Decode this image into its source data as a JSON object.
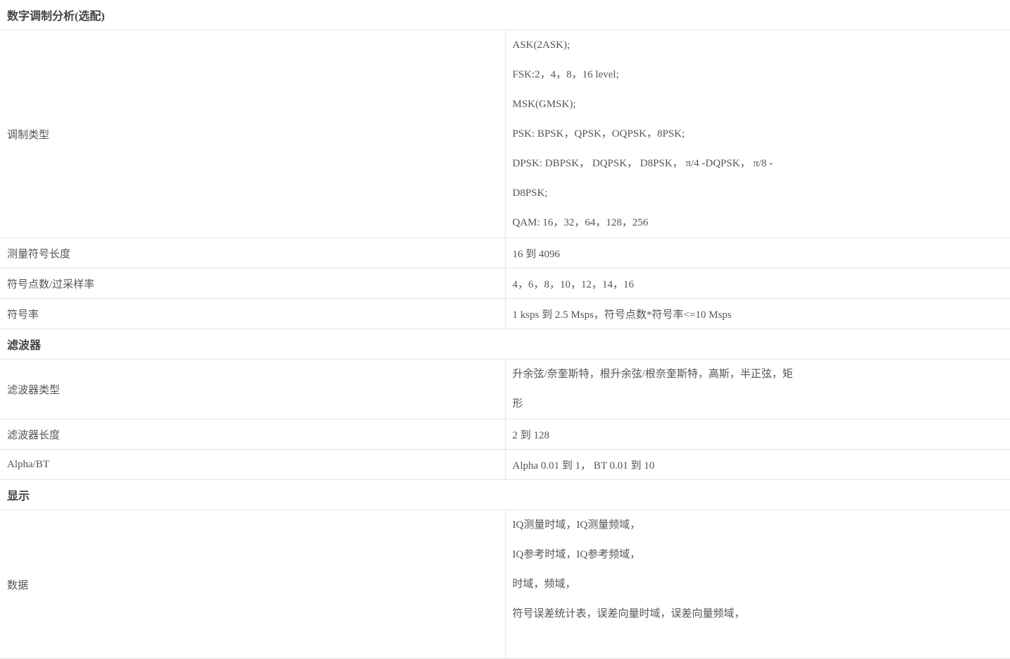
{
  "sections": {
    "digital_mod": "数字调制分析(选配)",
    "filter": "滤波器",
    "display": "显示"
  },
  "rows": {
    "mod_type": {
      "label": "调制类型",
      "lines": [
        "ASK(2ASK);",
        "FSK:2，4，8，16 level;",
        "MSK(GMSK);",
        "PSK: BPSK，QPSK，OQPSK，8PSK;",
        "DPSK: DBPSK， DQPSK， D8PSK， π/4 -DQPSK， π/8 -",
        "D8PSK;",
        "QAM: 16，32，64，128，256"
      ]
    },
    "symbol_length": {
      "label": "测量符号长度",
      "value": "16 到 4096"
    },
    "oversample": {
      "label": "符号点数/过采样率",
      "value": "4，6，8，10，12，14，16"
    },
    "symbol_rate": {
      "label": "符号率",
      "value": "1 ksps 到 2.5 Msps，符号点数*符号率<=10 Msps"
    },
    "filter_type": {
      "label": "滤波器类型",
      "lines": [
        "升余弦/奈奎斯特，根升余弦/根奈奎斯特，高斯，半正弦，矩",
        "形"
      ]
    },
    "filter_length": {
      "label": "滤波器长度",
      "value": "2 到 128"
    },
    "alpha_bt": {
      "label": "Alpha/BT",
      "value": "Alpha 0.01 到 1， BT 0.01 到 10"
    },
    "data": {
      "label": "数据",
      "lines": [
        "IQ测量时域，IQ测量频域，",
        "IQ参考时域，IQ参考频域，",
        "时域，频域，",
        "符号误差统计表，误差向量时域，误差向量频域，"
      ]
    }
  }
}
